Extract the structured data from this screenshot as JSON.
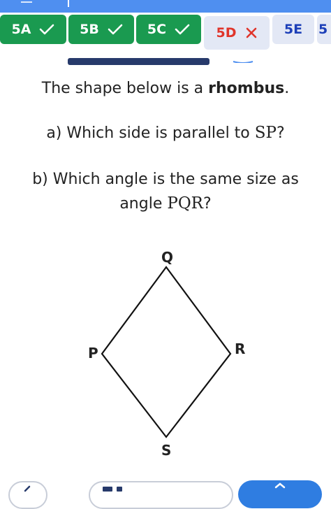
{
  "tabs": [
    {
      "label": "5A",
      "status": "correct"
    },
    {
      "label": "5B",
      "status": "correct"
    },
    {
      "label": "5C",
      "status": "correct"
    },
    {
      "label": "5D",
      "status": "incorrect"
    },
    {
      "label": "5E",
      "status": "pending"
    },
    {
      "label": "5",
      "status": "pending"
    }
  ],
  "question": {
    "intro_pre": "The shape below is a ",
    "intro_bold": "rhombus",
    "intro_post": ".",
    "part_a_pre": "a) Which side is parallel to ",
    "part_a_math": "SP",
    "part_a_post": "?",
    "part_b_line1": "b) Which angle is the same size as",
    "part_b_pre": "angle ",
    "part_b_math": "PQR",
    "part_b_post": "?"
  },
  "diagram": {
    "shape": "rhombus",
    "vertices": {
      "top": "Q",
      "left": "P",
      "right": "R",
      "bottom": "S"
    }
  },
  "colors": {
    "correct": "#1a9a50",
    "incorrect": "#e0352b",
    "pending_text": "#1c3fb8",
    "tab_bg": "#e3e8f5",
    "top_strip": "#4f8ff0",
    "progress": "#273a6b"
  },
  "icons": [
    "check-icon",
    "cross-icon"
  ]
}
